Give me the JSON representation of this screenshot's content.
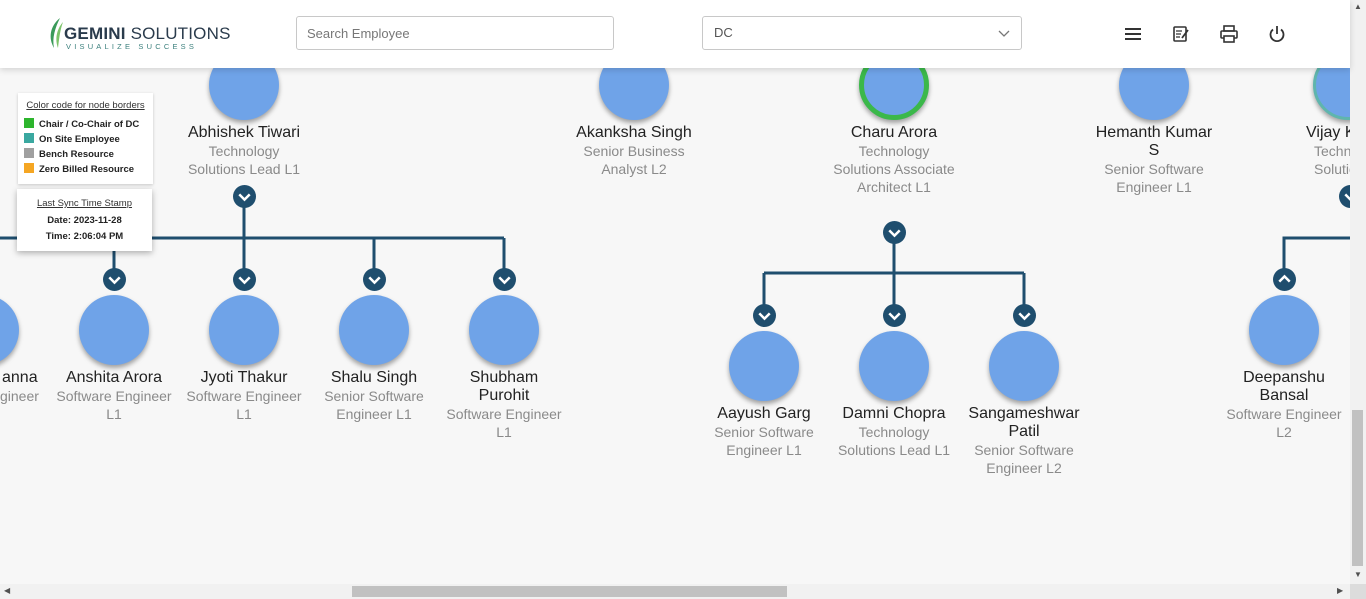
{
  "header": {
    "logo": {
      "brand_bold": "GEMINI",
      "brand_rest": " SOLUTIONS",
      "tagline": "VISUALIZE SUCCESS"
    },
    "search": {
      "placeholder": "Search Employee",
      "value": ""
    },
    "dc_select": {
      "value": "DC"
    },
    "icons": [
      "menu-icon",
      "notes-icon",
      "print-icon",
      "power-icon"
    ]
  },
  "legend": {
    "title": "Color code for node borders",
    "items": [
      {
        "label": "Chair / Co-Chair of DC",
        "color": "#2db52d"
      },
      {
        "label": "On Site Employee",
        "color": "#3aa8a0"
      },
      {
        "label": "Bench Resource",
        "color": "#a0a0a0"
      },
      {
        "label": "Zero Billed Resource",
        "color": "#f5a623"
      }
    ]
  },
  "sync": {
    "title": "Last Sync Time Stamp",
    "date": "Date: 2023-11-28",
    "time": "Time: 2:06:04 PM"
  },
  "nodes": {
    "abhishek": {
      "name": "Abhishek Tiwari",
      "designation": "Technology Solutions Lead L1"
    },
    "akanksha": {
      "name": "Akanksha Singh",
      "designation": "Senior Business Analyst L2"
    },
    "charu": {
      "name": "Charu Arora",
      "designation": "Technology Solutions Associate Architect L1"
    },
    "hemanth": {
      "name": "Hemanth Kumar S",
      "designation": "Senior Software Engineer L1"
    },
    "vijay": {
      "name": "Vijay K",
      "designation": "Techn Solutions"
    },
    "khanna": {
      "name": "anna",
      "designation": "gineer"
    },
    "anshita": {
      "name": "Anshita Arora",
      "designation": "Software Engineer L1"
    },
    "jyoti": {
      "name": "Jyoti Thakur",
      "designation": "Software Engineer L1"
    },
    "shalu": {
      "name": "Shalu Singh",
      "designation": "Senior Software Engineer L1"
    },
    "shubham": {
      "name": "Shubham Purohit",
      "designation": "Software Engineer L1"
    },
    "aayush": {
      "name": "Aayush Garg",
      "designation": "Senior Software Engineer L1"
    },
    "damni": {
      "name": "Damni Chopra",
      "designation": "Technology Solutions Lead L1"
    },
    "sangameshwar": {
      "name": "Sangameshwar Patil",
      "designation": "Senior Software Engineer L2"
    },
    "deepanshu": {
      "name": "Deepanshu Bansal",
      "designation": "Software Engineer L2"
    }
  },
  "colors": {
    "connector": "#1f4e6e",
    "node_fill": "#6fa3e8",
    "chair_border": "#3bb84a",
    "onsite_border": "#5fb5ad"
  }
}
